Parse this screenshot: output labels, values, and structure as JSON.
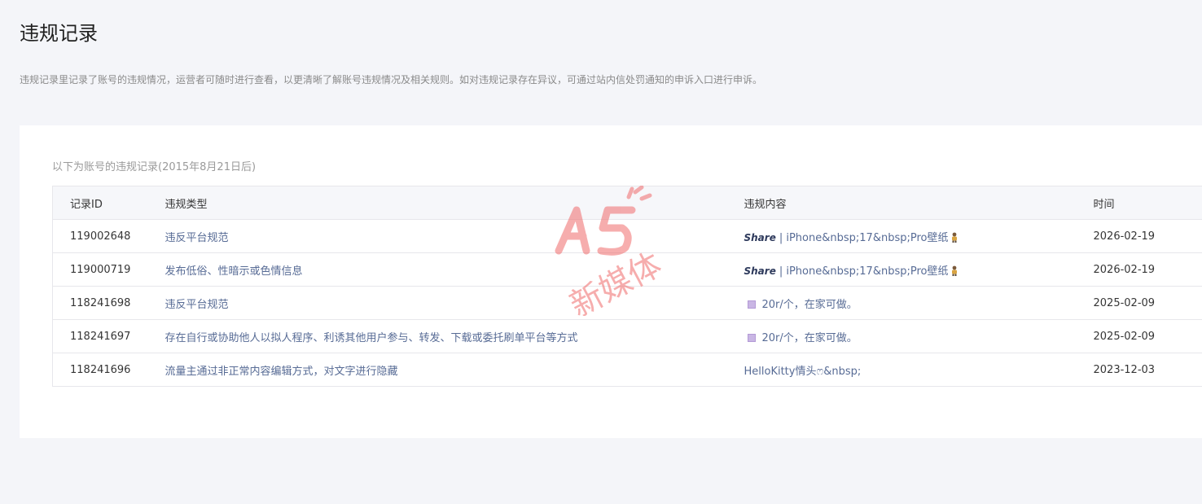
{
  "page": {
    "title": "违规记录",
    "description": "违规记录里记录了账号的违规情况，运营者可随时进行查看，以更清晰了解账号违规情况及相关规则。如对违规记录存在异议，可通过站内信处罚通知的申诉入口进行申诉。"
  },
  "card": {
    "note": "以下为账号的违规记录(2015年8月21日后)"
  },
  "table": {
    "headers": {
      "id": "记录ID",
      "type": "违规类型",
      "content": "违规内容",
      "time": "时间"
    },
    "rows": [
      {
        "id": "119002648",
        "type": "违反平台规范",
        "share": "Share",
        "content": "| iPhone&nbsp;17&nbsp;Pro壁纸",
        "emoji": "person-figure-icon",
        "time": "2026-02-19"
      },
      {
        "id": "119000719",
        "type": "发布低俗、性暗示或色情信息",
        "share": "Share",
        "content": "| iPhone&nbsp;17&nbsp;Pro壁纸",
        "emoji": "person-figure-icon",
        "time": "2026-02-19"
      },
      {
        "id": "118241698",
        "type": "违反平台规范",
        "share": "",
        "content": "20r/个，在家可做。",
        "emoji": "purple-square-icon",
        "time": "2025-02-09"
      },
      {
        "id": "118241697",
        "type": "存在自行或协助他人以拟人程序、利诱其他用户参与、转发、下载或委托刷单平台等方式",
        "share": "",
        "content": "20r/个，在家可做。",
        "emoji": "purple-square-icon",
        "time": "2025-02-09"
      },
      {
        "id": "118241696",
        "type": "流量主通过非正常内容编辑方式，对文字进行隐藏",
        "share": "",
        "content": "HelloKitty情头ෆ&nbsp;",
        "emoji": "",
        "time": "2023-12-03"
      }
    ]
  },
  "watermark": {
    "logo_text": "A5",
    "subtext": "新媒体",
    "color": "#f06b6b"
  }
}
